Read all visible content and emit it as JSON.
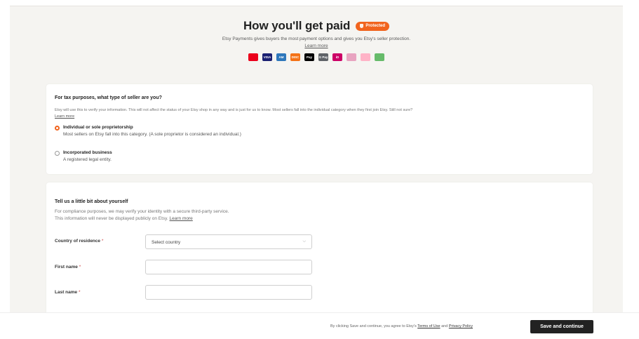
{
  "hero": {
    "title": "How you'll get paid",
    "badge": "Protected",
    "subtitle": "Etsy Payments gives buyers the most payment options and gives you Etsy's seller protection.",
    "learn_more": "Learn more",
    "payment_methods": [
      {
        "name": "mastercard-icon",
        "label": "",
        "color": "#eb001b"
      },
      {
        "name": "visa-icon",
        "label": "VISA",
        "color": "#1a1f71"
      },
      {
        "name": "amex-icon",
        "label": "AM",
        "color": "#2e77bb"
      },
      {
        "name": "discover-icon",
        "label": "DISC",
        "color": "#f47216"
      },
      {
        "name": "apple-pay-icon",
        "label": "Pay",
        "color": "#000000"
      },
      {
        "name": "google-pay-icon",
        "label": "G Pay",
        "color": "#5f6368"
      },
      {
        "name": "ideal-icon",
        "label": "iD",
        "color": "#cc0066"
      },
      {
        "name": "bancontact-icon",
        "label": "",
        "color": "#e8a3c0"
      },
      {
        "name": "klarna-icon",
        "label": "",
        "color": "#ffb3c7"
      },
      {
        "name": "sofort-icon",
        "label": "",
        "color": "#66bb6a"
      }
    ]
  },
  "tax": {
    "title": "For tax purposes, what type of seller are you?",
    "help": "Etsy will use this to verify your information. This will not affect the status of your Etsy shop in any way and is just for us to know. Most sellers fall into the individual category when they first join Etsy. Still not sure?",
    "help_link": "Learn more",
    "options": [
      {
        "label": "Individual or sole proprietorship",
        "desc": "Most sellers on Etsy fall into this category. (A sole proprietor is considered an individual.)",
        "selected": true
      },
      {
        "label": "Incorporated business",
        "desc": "A registered legal entity.",
        "selected": false
      }
    ]
  },
  "about": {
    "title": "Tell us a little bit about yourself",
    "help_line1": "For compliance purposes, we may verify your identity with a secure third-party service.",
    "help_line2": "This information will never be displayed publicly on Etsy.",
    "help_link": "Learn more",
    "fields": {
      "country": {
        "label": "Country of residence",
        "value": "Select country"
      },
      "first_name": {
        "label": "First name",
        "value": ""
      },
      "last_name": {
        "label": "Last name",
        "value": ""
      }
    },
    "required_mark": "*"
  },
  "footer": {
    "legal_prefix": "By clicking Save and continue, you agree to Etsy's",
    "terms": "Terms of Use",
    "and": "and",
    "privacy": "Privacy Policy",
    "save_label": "Save and continue"
  },
  "colors": {
    "accent": "#f1641e",
    "button": "#222222",
    "background": "#f5f4f1"
  }
}
